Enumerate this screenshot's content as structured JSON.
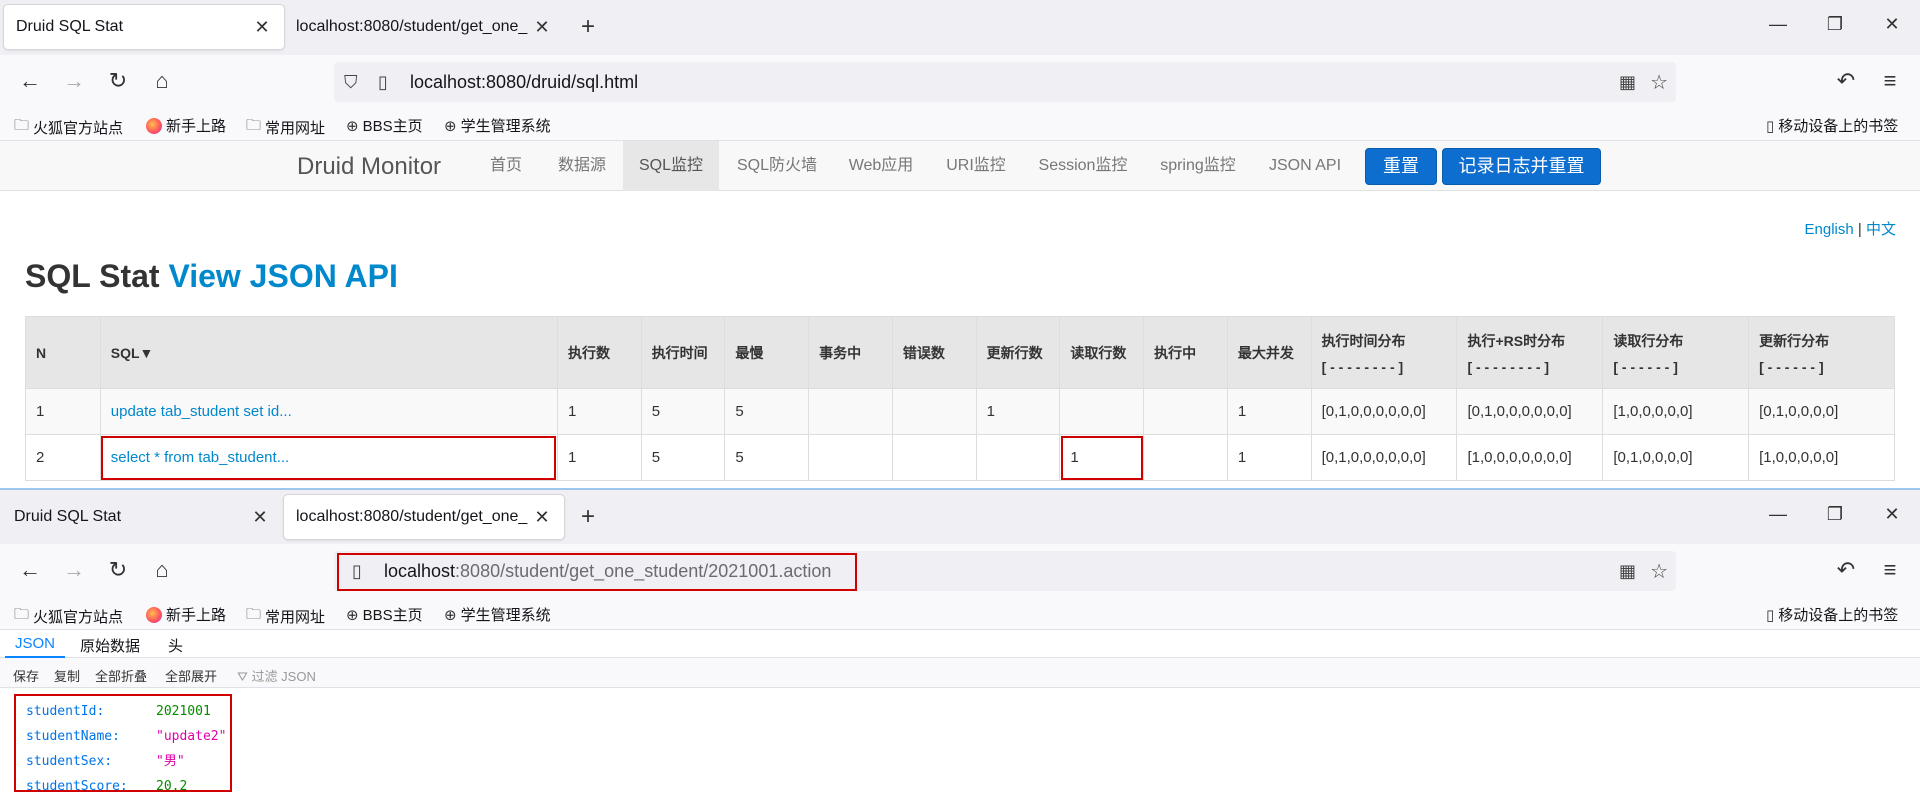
{
  "colors": {
    "accent_blue": "#0088cc",
    "button_blue": "#0d6ecf",
    "highlight_red": "#d00000"
  },
  "window1": {
    "tabs": [
      {
        "title": "Druid SQL Stat",
        "active": true
      },
      {
        "title": "localhost:8080/student/get_one_",
        "active": false
      }
    ],
    "url": "localhost:8080/druid/sql.html",
    "bookmarks": [
      "火狐官方站点",
      "新手上路",
      "常用网址",
      "BBS主页",
      "学生管理系统"
    ],
    "mobile_bookmarks": "移动设备上的书签",
    "druid": {
      "brand": "Druid Monitor",
      "nav": [
        "首页",
        "数据源",
        "SQL监控",
        "SQL防火墙",
        "Web应用",
        "URI监控",
        "Session监控",
        "spring监控",
        "JSON API"
      ],
      "reset_button": "重置",
      "log_reset_button": "记录日志并重置",
      "lang_en": "English",
      "lang_sep": "|",
      "lang_zh": "中文",
      "title": "SQL Stat",
      "title_link": "View JSON API",
      "table": {
        "headers": [
          "N",
          "SQL▼",
          "执行数",
          "执行时间",
          "最慢",
          "事务中",
          "错误数",
          "更新行数",
          "读取行数",
          "执行中",
          "最大并发",
          "执行时间分布",
          "执行+RS时分布",
          "读取行分布",
          "更新行分布"
        ],
        "header_sub": {
          "11": "[ - - - - - - - - ]",
          "12": "[ - - - - - - - - ]",
          "13": "[ - - - - - - ]",
          "14": "[ - - - - - - ]"
        },
        "rows": [
          [
            "1",
            "update tab_student set id...",
            "1",
            "5",
            "5",
            "",
            "",
            "1",
            "",
            "",
            "1",
            "[0,1,0,0,0,0,0,0]",
            "[0,1,0,0,0,0,0,0]",
            "[1,0,0,0,0,0]",
            "[0,1,0,0,0,0]"
          ],
          [
            "2",
            "select * from tab_student...",
            "1",
            "5",
            "5",
            "",
            "",
            "",
            "1",
            "",
            "1",
            "[0,1,0,0,0,0,0,0]",
            "[1,0,0,0,0,0,0,0]",
            "[0,1,0,0,0,0]",
            "[1,0,0,0,0,0]"
          ]
        ]
      }
    }
  },
  "window2": {
    "tabs": [
      {
        "title": "Druid SQL Stat",
        "active": false
      },
      {
        "title": "localhost:8080/student/get_one_",
        "active": true
      }
    ],
    "url_host": "localhost",
    "url_rest": ":8080/student/get_one_student/2021001.action",
    "bookmarks": [
      "火狐官方站点",
      "新手上路",
      "常用网址",
      "BBS主页",
      "学生管理系统"
    ],
    "mobile_bookmarks": "移动设备上的书签",
    "json_tabs": [
      "JSON",
      "原始数据",
      "头"
    ],
    "json_tools": [
      "保存",
      "复制",
      "全部折叠",
      "全部展开"
    ],
    "filter_placeholder": "过滤 JSON",
    "json": [
      {
        "key": "studentId:",
        "value": "2021001",
        "type": "number"
      },
      {
        "key": "studentName:",
        "value": "\"update2\"",
        "type": "string"
      },
      {
        "key": "studentSex:",
        "value": "\"男\"",
        "type": "string"
      },
      {
        "key": "studentScore:",
        "value": "20.2",
        "type": "number"
      }
    ]
  }
}
